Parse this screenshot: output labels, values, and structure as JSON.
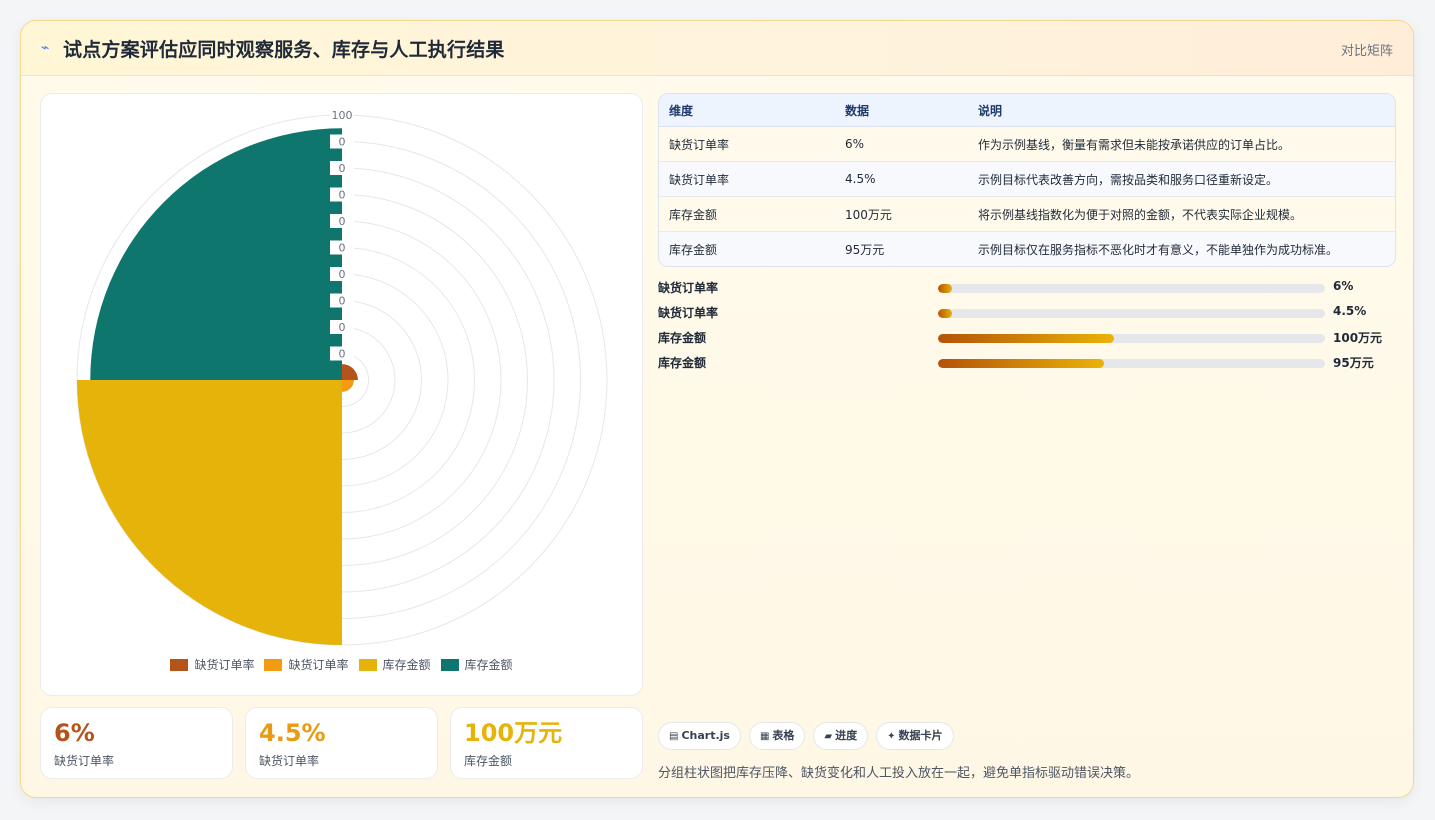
{
  "header": {
    "icon": "lightning-icon",
    "title": "试点方案评估应同时观察服务、库存与人工执行结果",
    "tag": "对比矩阵"
  },
  "chart_data": {
    "type": "polarArea",
    "categories": [
      "缺货订单率",
      "缺货订单率",
      "库存金额",
      "库存金额"
    ],
    "values": [
      6,
      4.5,
      100,
      95
    ],
    "colors": [
      "#b4531a",
      "#f39c12",
      "#e6b30b",
      "#0f766e"
    ],
    "rmax": 100,
    "tick_labels": [
      "0",
      "0",
      "0",
      "0",
      "0",
      "0",
      "0",
      "0",
      "0",
      "100"
    ],
    "legend": [
      "缺货订单率",
      "缺货订单率",
      "库存金额",
      "库存金额"
    ],
    "legend_position": "bottom"
  },
  "kpis": [
    {
      "value": "6%",
      "label": "缺货订单率",
      "color": "#b4531a"
    },
    {
      "value": "4.5%",
      "label": "缺货订单率",
      "color": "#e89b12"
    },
    {
      "value": "100万元",
      "label": "库存金额",
      "color": "#e6b30b"
    }
  ],
  "table": {
    "headers": [
      "维度",
      "数据",
      "说明"
    ],
    "rows": [
      [
        "缺货订单率",
        "6%",
        "作为示例基线，衡量有需求但未能按承诺供应的订单占比。"
      ],
      [
        "缺货订单率",
        "4.5%",
        "示例目标代表改善方向，需按品类和服务口径重新设定。"
      ],
      [
        "库存金额",
        "100万元",
        "将示例基线指数化为便于对照的金额，不代表实际企业规模。"
      ],
      [
        "库存金额",
        "95万元",
        "示例目标仅在服务指标不恶化时才有意义，不能单独作为成功标准。"
      ]
    ]
  },
  "bars": [
    {
      "label": "缺货订单率",
      "value": "6%",
      "fraction": 0.035
    },
    {
      "label": "缺货订单率",
      "value": "4.5%",
      "fraction": 0.035
    },
    {
      "label": "库存金额",
      "value": "100万元",
      "fraction": 0.455
    },
    {
      "label": "库存金额",
      "value": "95万元",
      "fraction": 0.43
    }
  ],
  "chips": [
    {
      "icon": "chart-icon",
      "glyph": "▤",
      "label": "Chart.js"
    },
    {
      "icon": "table-icon",
      "glyph": "▦",
      "label": "表格"
    },
    {
      "icon": "progress-icon",
      "glyph": "▰",
      "label": "进度"
    },
    {
      "icon": "sparkle-icon",
      "glyph": "✦",
      "label": "数据卡片"
    }
  ],
  "footnote": "分组柱状图把库存压降、缺货变化和人工投入放在一起，避免单指标驱动错误决策。"
}
